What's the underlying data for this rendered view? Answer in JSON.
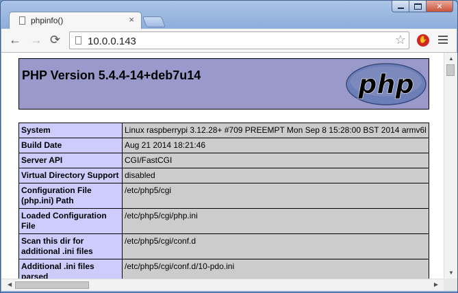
{
  "browser": {
    "tab_title": "phpinfo()",
    "tab_close_glyph": "×",
    "url": "10.0.0.143",
    "icons": {
      "back": "←",
      "forward": "→",
      "reload": "⟳",
      "star": "☆",
      "extension": "adblock-icon",
      "menu": "hamburger-menu-icon",
      "close_window": "✕"
    },
    "colors": {
      "frame": "#8eaedb",
      "tab_bg": "#f6f6f6"
    }
  },
  "page": {
    "title": "PHP Version 5.4.4-14+deb7u14",
    "logo_text": "php",
    "colors": {
      "header_bg": "#9999cc",
      "key_bg": "#ccccff",
      "value_bg": "#cccccc"
    },
    "rows": [
      {
        "key": "System",
        "value": "Linux raspberrypi 3.12.28+ #709 PREEMPT Mon Sep 8 15:28:00 BST 2014 armv6l"
      },
      {
        "key": "Build Date",
        "value": "Aug 21 2014 18:21:46"
      },
      {
        "key": "Server API",
        "value": "CGI/FastCGI"
      },
      {
        "key": "Virtual Directory Support",
        "value": "disabled"
      },
      {
        "key": "Configuration File (php.ini) Path",
        "value": "/etc/php5/cgi"
      },
      {
        "key": "Loaded Configuration File",
        "value": "/etc/php5/cgi/php.ini"
      },
      {
        "key": "Scan this dir for additional .ini files",
        "value": "/etc/php5/cgi/conf.d"
      },
      {
        "key": "Additional .ini files parsed",
        "value": "/etc/php5/cgi/conf.d/10-pdo.ini"
      }
    ]
  }
}
